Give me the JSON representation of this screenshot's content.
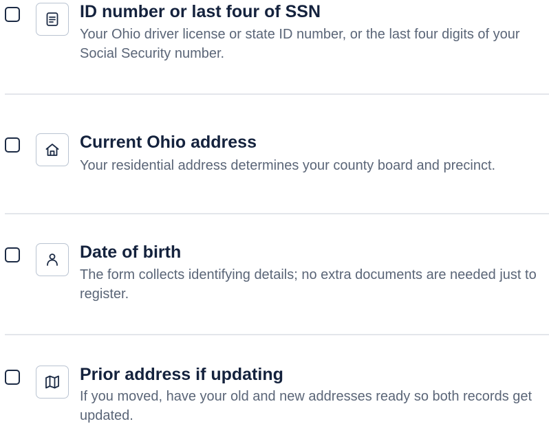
{
  "checklist": {
    "items": [
      {
        "title": "ID number or last four of SSN",
        "description": "Your Ohio driver license or state ID number, or the last four digits of your Social Security number.",
        "icon": "document-icon",
        "checked": false
      },
      {
        "title": "Current Ohio address",
        "description": "Your residential address determines your county board and precinct.",
        "icon": "home-icon",
        "checked": false
      },
      {
        "title": "Date of birth",
        "description": "The form collects identifying details; no extra documents are needed just to register.",
        "icon": "person-icon",
        "checked": false
      },
      {
        "title": "Prior address if updating",
        "description": "If you moved, have your old and new addresses ready so both records get updated.",
        "icon": "map-icon",
        "checked": false
      }
    ]
  }
}
